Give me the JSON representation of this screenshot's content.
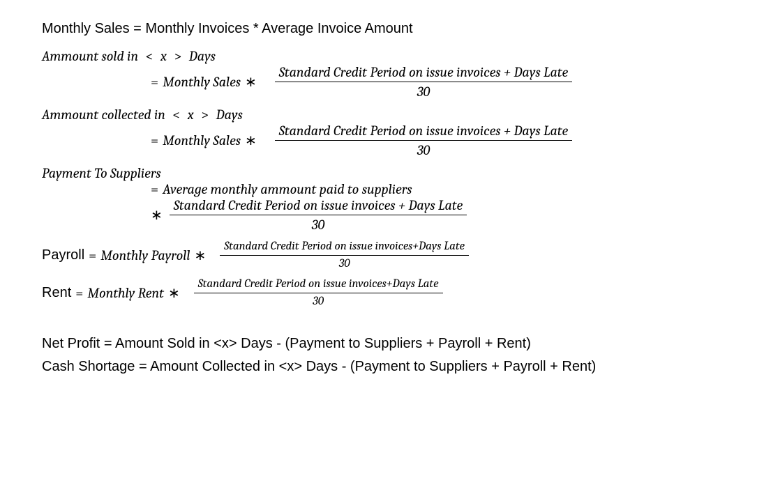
{
  "line1": {
    "text": "Monthly Sales = Monthly Invoices * Average Invoice Amount"
  },
  "eq1": {
    "lhs_pre": "Ammount sold in ",
    "lhs_lt": "<",
    "lhs_x": " x ",
    "lhs_gt": ">",
    "lhs_post": "  Days",
    "eq": "= ",
    "rhs_a": "Monthly Sales ",
    "mult": "∗",
    "num": "Standard Credit Period on issue invoices + Days Late",
    "den": "30"
  },
  "eq2": {
    "lhs_pre": "Ammount collected in ",
    "lhs_lt": "<",
    "lhs_x": " x ",
    "lhs_gt": ">",
    "lhs_post": "  Days",
    "eq": "= ",
    "rhs_a": "Monthly Sales ",
    "mult": "∗",
    "num": "Standard Credit Period on issue invoices + Days Late",
    "den": "30"
  },
  "eq3": {
    "lhs": "Payment To Suppliers",
    "eq": "= ",
    "line1_rest": "Average monthly ammount paid to suppliers",
    "mult": "∗",
    "num": "Standard Credit Period on issue invoices + Days Late",
    "den": "30"
  },
  "eq4": {
    "lhs_label": "Payroll",
    "eq": "  = ",
    "rhs_a": "Monthly Payroll ",
    "mult": "∗",
    "num": "Standard Credit Period on issue invoices+Days Late",
    "den": "30"
  },
  "eq5": {
    "lhs_label": "Rent",
    "eq": "  = ",
    "rhs_a": "Monthly Rent ",
    "mult": "∗",
    "num": "Standard Credit Period on issue invoices+Days Late",
    "den": "30"
  },
  "line_net": {
    "text": "Net Profit = Amount Sold in <x> Days - (Payment to Suppliers + Payroll + Rent)"
  },
  "line_cash": {
    "text": "Cash Shortage = Amount Collected in <x> Days - (Payment to Suppliers + Payroll + Rent)"
  }
}
